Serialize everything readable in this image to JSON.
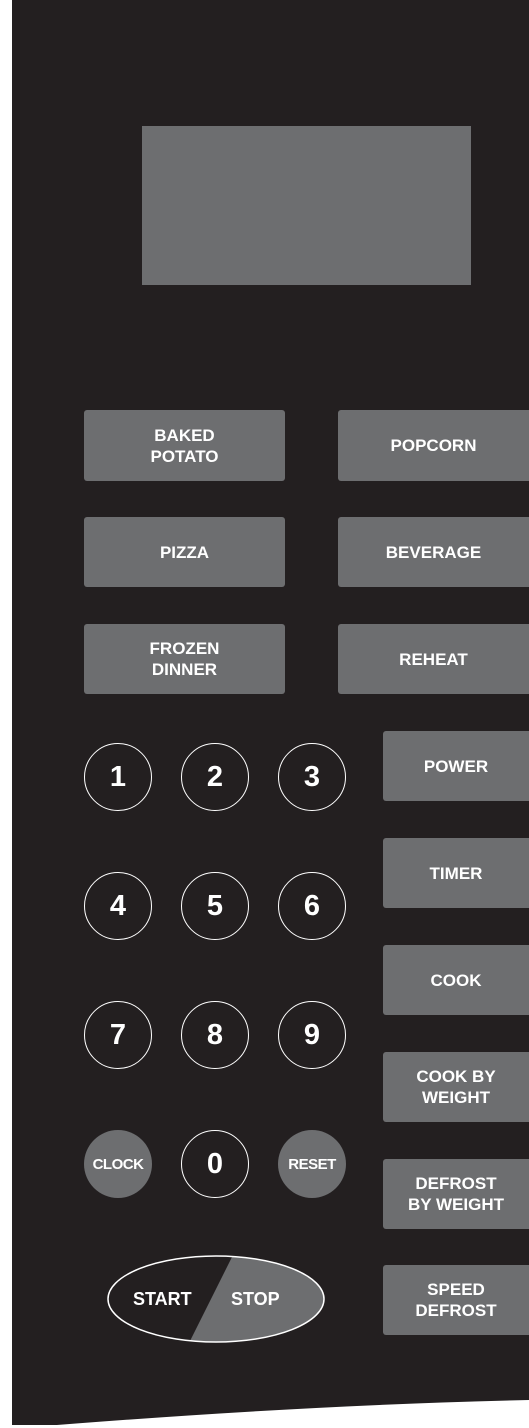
{
  "colors": {
    "panel": "#231f20",
    "key": "#6d6e70",
    "text": "#ffffff"
  },
  "presets": {
    "baked_potato": "BAKED\nPOTATO",
    "popcorn": "POPCORN",
    "pizza": "PIZZA",
    "beverage": "BEVERAGE",
    "frozen_dinner": "FROZEN\nDINNER",
    "reheat": "REHEAT"
  },
  "function_keys": {
    "power": "POWER",
    "timer": "TIMER",
    "cook": "COOK",
    "cook_by_weight": "COOK BY\nWEIGHT",
    "defrost_by_weight": "DEFROST\nBY WEIGHT",
    "speed_defrost": "SPEED\nDEFROST"
  },
  "numpad": {
    "digits": [
      "1",
      "2",
      "3",
      "4",
      "5",
      "6",
      "7",
      "8",
      "9",
      "0"
    ],
    "clock": "CLOCK",
    "reset": "RESET"
  },
  "start_stop": {
    "start": "START",
    "stop": "STOP"
  }
}
